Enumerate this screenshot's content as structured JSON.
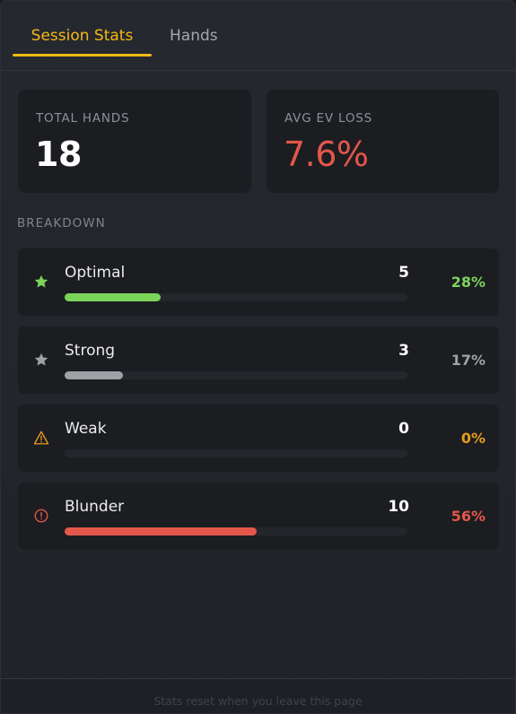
{
  "tabs": [
    {
      "label": "Session Stats",
      "active": true
    },
    {
      "label": "Hands",
      "active": false
    }
  ],
  "summary": {
    "total_hands": {
      "label": "TOTAL HANDS",
      "value": "18"
    },
    "avg_ev_loss": {
      "label": "AVG EV LOSS",
      "value": "7.6%",
      "color": "#e4574b"
    }
  },
  "breakdown": {
    "label": "BREAKDOWN",
    "rows": [
      {
        "name": "Optimal",
        "count": "5",
        "percent": "28%",
        "fraction": 0.28,
        "color": "#7bd45a",
        "icon": "star-icon"
      },
      {
        "name": "Strong",
        "count": "3",
        "percent": "17%",
        "fraction": 0.17,
        "color": "#9fa1a7",
        "icon": "star-icon"
      },
      {
        "name": "Weak",
        "count": "0",
        "percent": "0%",
        "fraction": 0.0,
        "color": "#e89a1c",
        "icon": "warning-icon"
      },
      {
        "name": "Blunder",
        "count": "10",
        "percent": "56%",
        "fraction": 0.56,
        "color": "#e4574b",
        "icon": "alert-circle-icon"
      }
    ]
  },
  "footer": {
    "text": "Stats reset when you leave this page"
  }
}
